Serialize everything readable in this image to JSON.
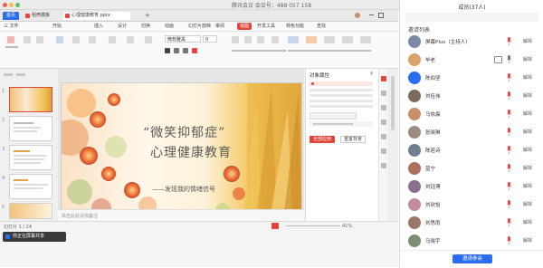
{
  "window": {
    "meeting_title": "腾讯会议 会议号：488 057 158"
  },
  "browser_tabs": [
    {
      "label": "首页"
    },
    {
      "label": "稻壳模板"
    },
    {
      "label": "心理健康教育.pptx"
    }
  ],
  "menu": {
    "items": [
      "三 文件",
      "开始",
      "插入",
      "设计",
      "切换",
      "动画",
      "幻灯片放映",
      "审阅",
      "视图",
      "开发工具",
      "特色功能",
      "查找"
    ]
  },
  "ribbon": {
    "font_name": "微软雅黑",
    "font_size": "0"
  },
  "slide": {
    "title_line1": "“微笑抑郁症”",
    "title_line2": "心理健康教育",
    "subtitle": "——发现我的情绪信号"
  },
  "thumbnails": [
    {
      "number": "1"
    },
    {
      "number": "2"
    },
    {
      "number": "3"
    },
    {
      "number": "4"
    },
    {
      "number": "5"
    }
  ],
  "taskpane": {
    "title": "对象属性",
    "button_primary": "全部应用",
    "button_secondary": "重置背景"
  },
  "notes": {
    "placeholder": "单击此处添加备注"
  },
  "status": {
    "slide_label": "幻灯片 1 / 24",
    "zoom": "41%"
  },
  "share_bar": {
    "label": "你正在屏幕共享"
  },
  "participants": {
    "panel_title": "成员(37人)",
    "heading": "邀请列表",
    "rows": [
      {
        "name": "屏幕Plus（主持人）",
        "action": "解除",
        "avatar_color": "#7a8aa6"
      },
      {
        "name": "毕老",
        "action": "解除",
        "avatar_color": "#d9a36b"
      },
      {
        "name": "陈伯坚",
        "action": "解除",
        "avatar_color": "#2b6df0"
      },
      {
        "name": "刘佳伟",
        "action": "解除",
        "avatar_color": "#7c6b5a"
      },
      {
        "name": "马依晨",
        "action": "解除",
        "avatar_color": "#c98f6a"
      },
      {
        "name": "张晓琳",
        "action": "解除",
        "avatar_color": "#9b8c7f"
      },
      {
        "name": "陈若诗",
        "action": "解除",
        "avatar_color": "#6f7f8f"
      },
      {
        "name": "蓝宁",
        "action": "解除",
        "avatar_color": "#b0705e"
      },
      {
        "name": "刘钰博",
        "action": "解除",
        "avatar_color": "#8a6f8e"
      },
      {
        "name": "刘欣怡",
        "action": "解除",
        "avatar_color": "#c28e9b"
      },
      {
        "name": "刘思雨",
        "action": "解除",
        "avatar_color": "#9a7868"
      },
      {
        "name": "马晓宇",
        "action": "解除",
        "avatar_color": "#7d8f73"
      }
    ],
    "invite_button": "邀请参会"
  },
  "colors": {
    "accent_blue": "#2b6df0",
    "wps_red": "#e2453a",
    "mute_red": "#e04b4b"
  }
}
